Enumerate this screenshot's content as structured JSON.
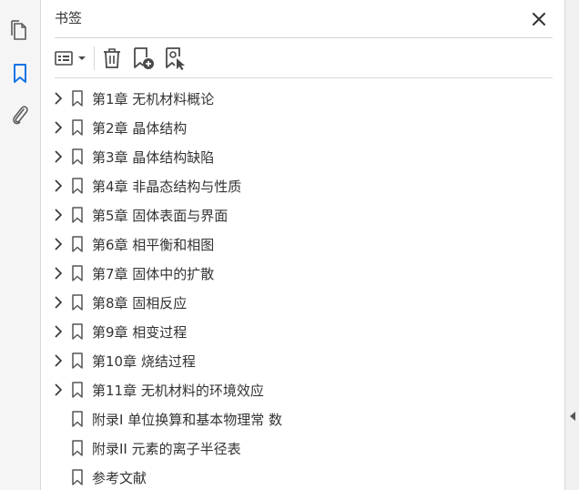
{
  "panel": {
    "title": "书签"
  },
  "rail": {
    "icons": [
      "pages-icon",
      "bookmark-icon",
      "attachment-icon"
    ],
    "active_color": "#1473e6"
  },
  "toolbar": {
    "icons": [
      "options-menu-icon",
      "delete-icon",
      "new-bookmark-icon",
      "bookmark-from-selection-icon"
    ]
  },
  "bookmarks": [
    {
      "label": "第1章 无机材料概论",
      "expandable": true
    },
    {
      "label": "第2章 晶体结构",
      "expandable": true
    },
    {
      "label": "第3章 晶体结构缺陷",
      "expandable": true
    },
    {
      "label": "第4章 非晶态结构与性质",
      "expandable": true
    },
    {
      "label": "第5章 固体表面与界面",
      "expandable": true
    },
    {
      "label": "第6章 相平衡和相图",
      "expandable": true
    },
    {
      "label": "第7章 固体中的扩散",
      "expandable": true
    },
    {
      "label": "第8章 固相反应",
      "expandable": true
    },
    {
      "label": "第9章 相变过程",
      "expandable": true
    },
    {
      "label": "第10章 烧结过程",
      "expandable": true
    },
    {
      "label": "第11章 无机材料的环境效应",
      "expandable": true
    },
    {
      "label": "附录I 单位换算和基本物理常 数",
      "expandable": false
    },
    {
      "label": "附录II 元素的离子半径表",
      "expandable": false
    },
    {
      "label": "参考文献",
      "expandable": false
    }
  ]
}
